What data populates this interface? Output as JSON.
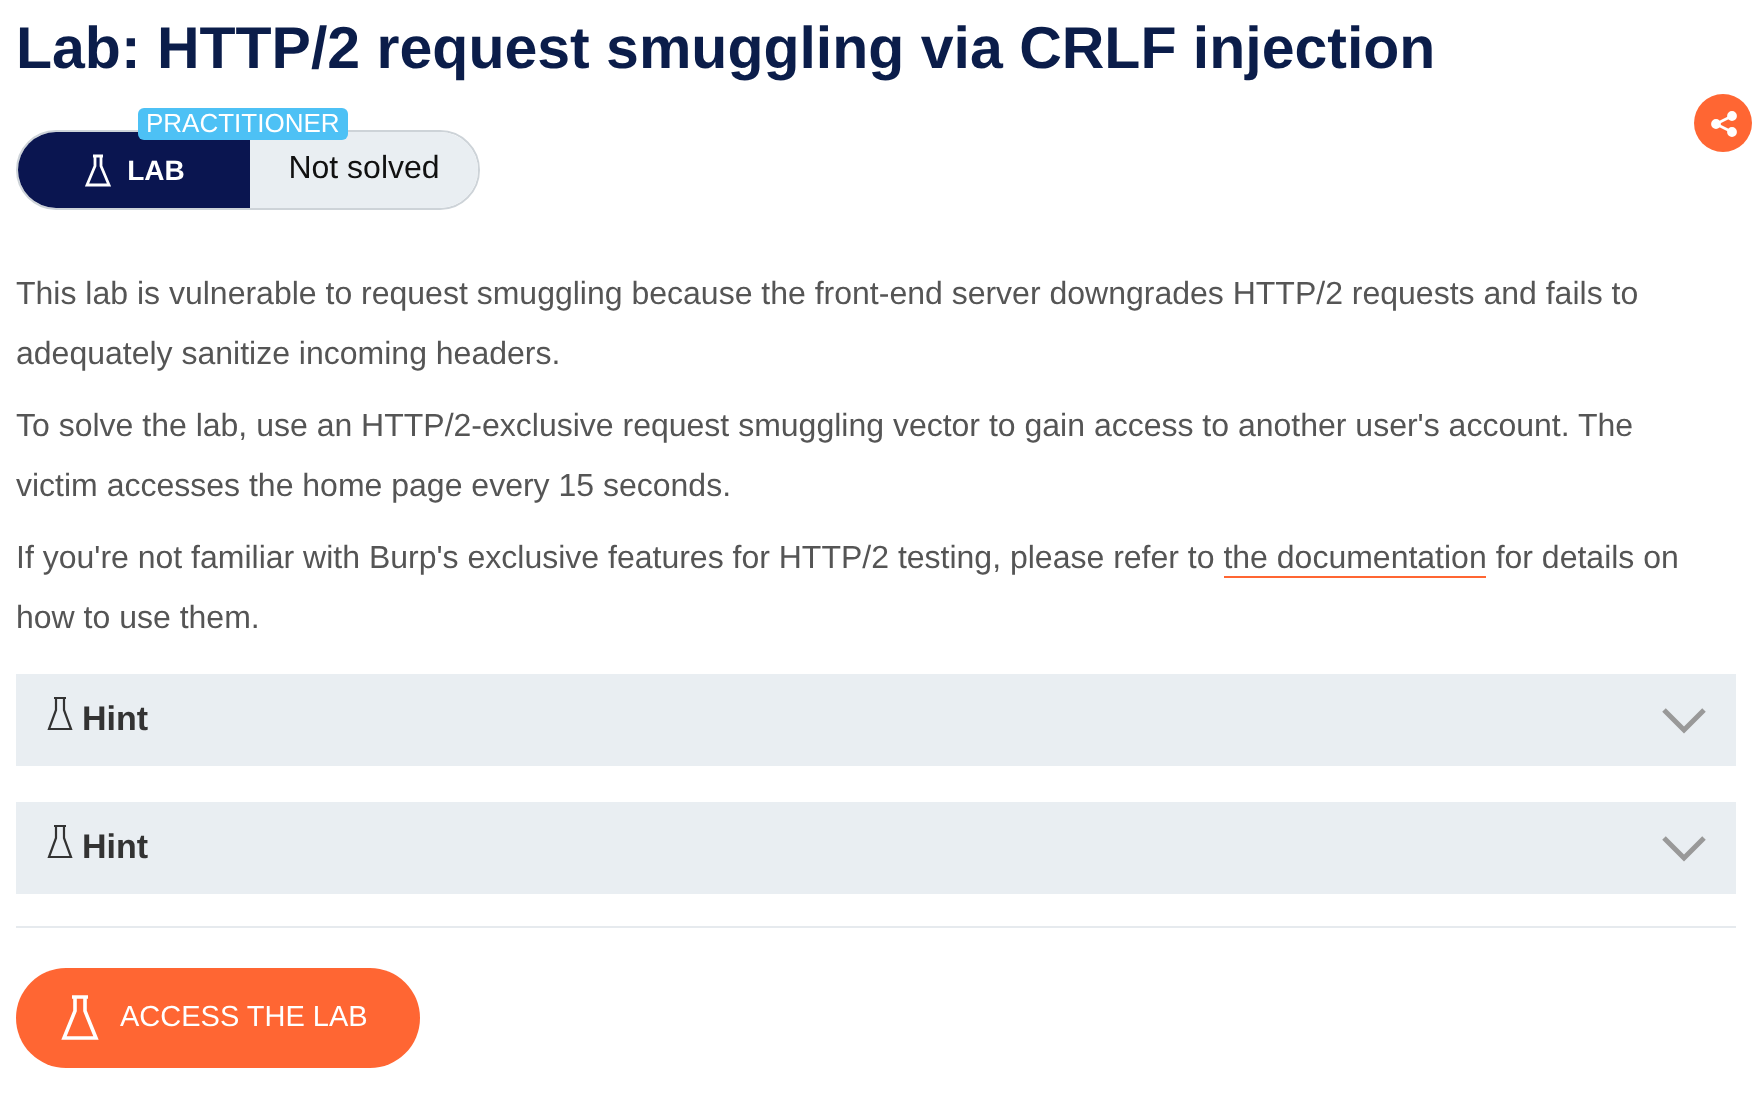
{
  "title": "Lab: HTTP/2 request smuggling via CRLF injection",
  "level_badge": "PRACTITIONER",
  "lab_label": "LAB",
  "status": "Not solved",
  "paragraphs": [
    {
      "text": "This lab is vulnerable to request smuggling because the front-end server downgrades HTTP/2 requests and fails to adequately sanitize incoming headers."
    },
    {
      "text": "To solve the lab, use an HTTP/2-exclusive request smuggling vector to gain access to another user's account. The victim accesses the home page every 15 seconds."
    },
    {
      "text": "If you're not familiar with Burp's exclusive features for HTTP/2 testing, please refer to",
      "link": "the documentation",
      "after": "for details on how to use them."
    }
  ],
  "hints": [
    {
      "label": "Hint",
      "expanded": false
    },
    {
      "label": "Hint",
      "expanded": false
    }
  ],
  "access_button": "ACCESS THE LAB"
}
